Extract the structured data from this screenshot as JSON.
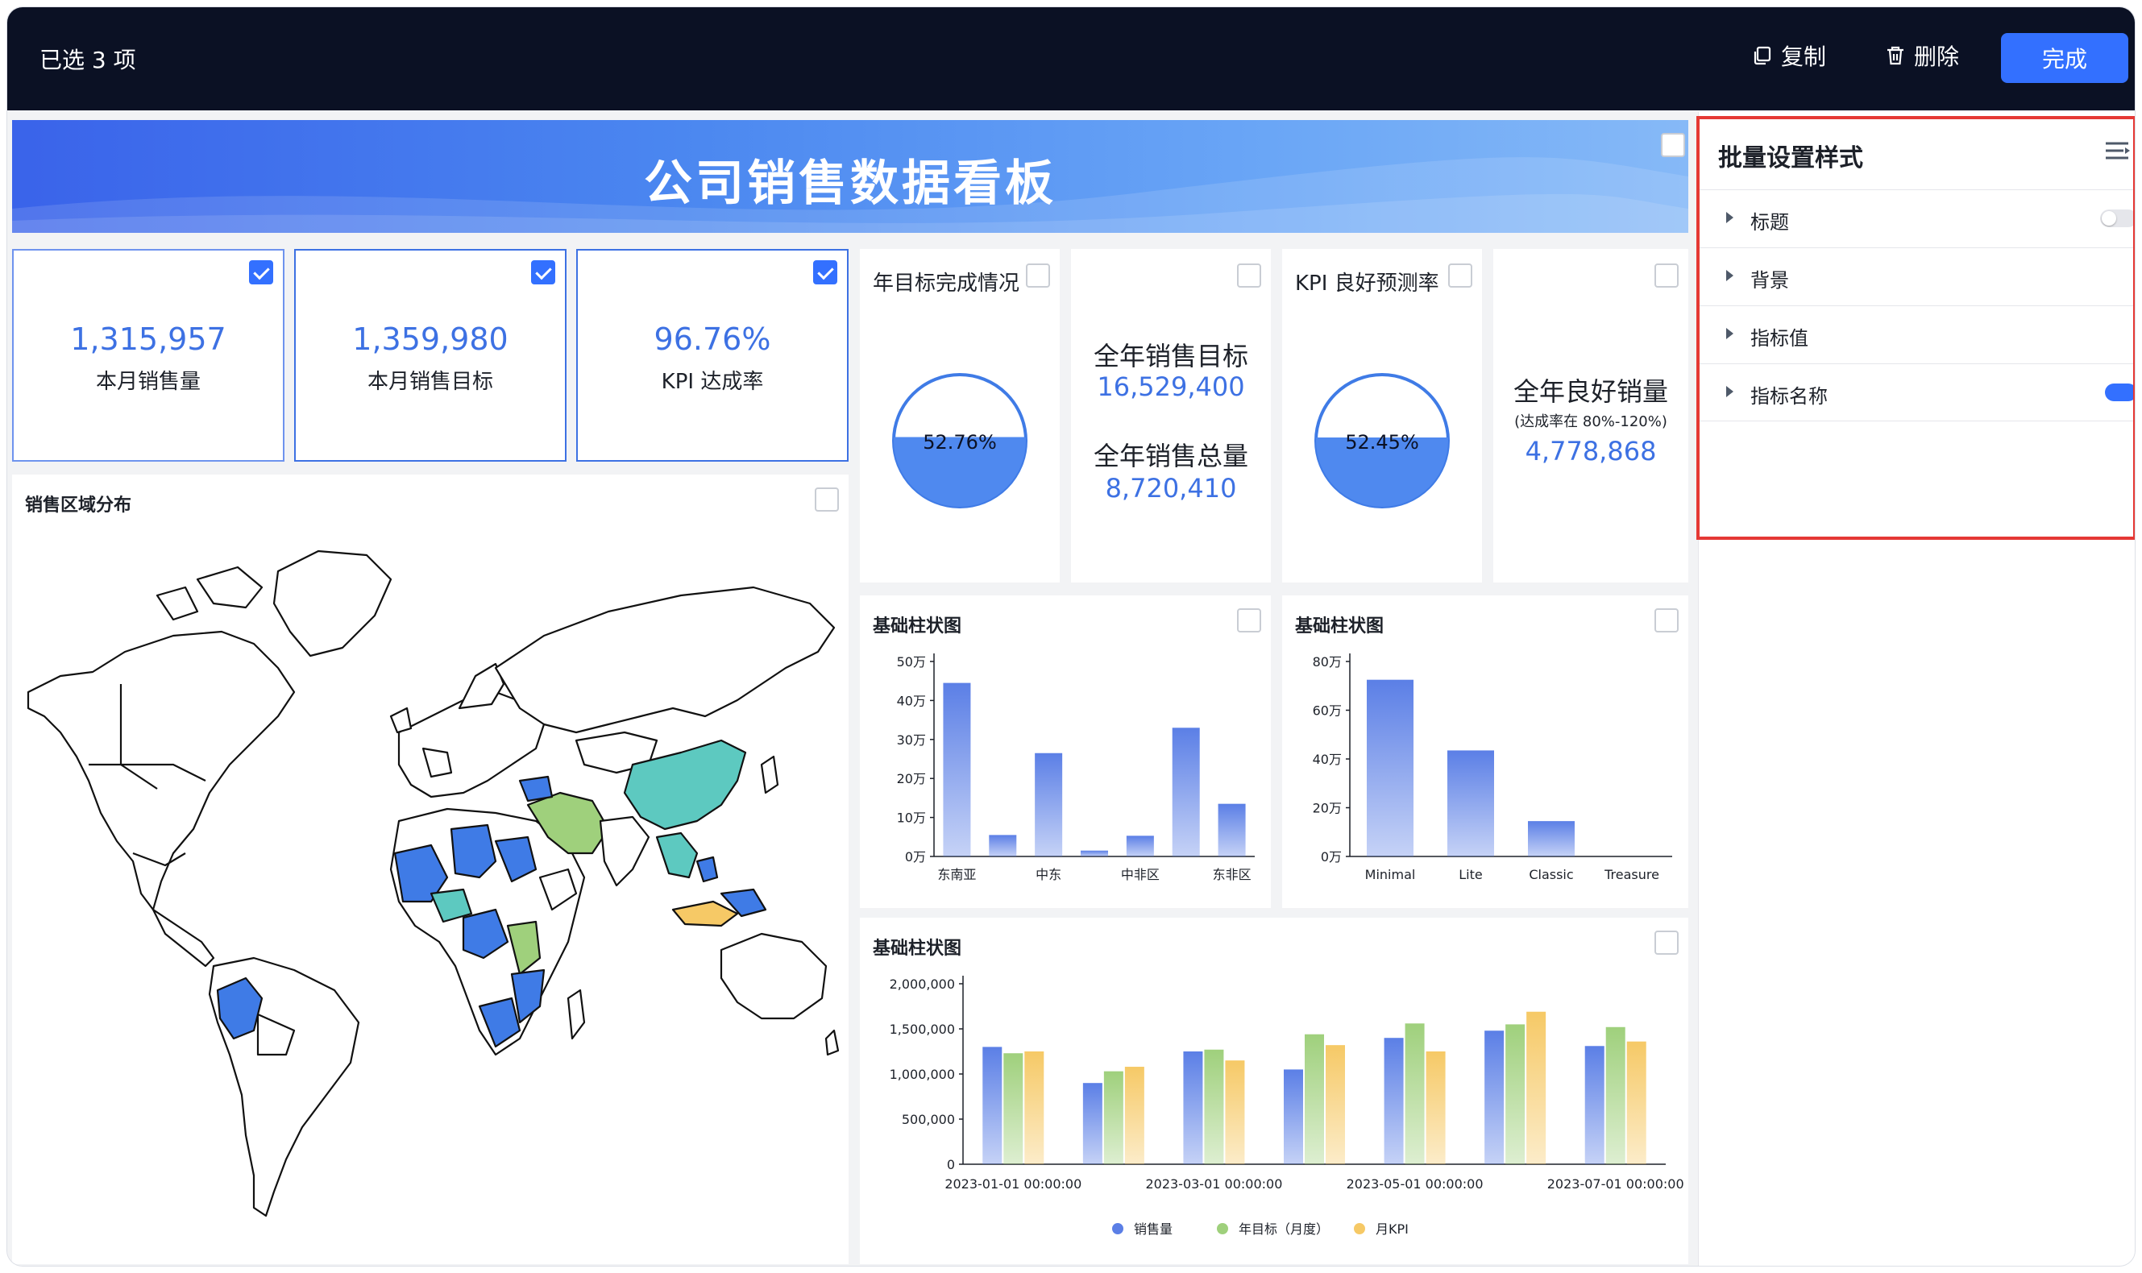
{
  "topbar": {
    "selected": "已选 3 项",
    "copy": "复制",
    "delete": "删除",
    "done": "完成"
  },
  "banner": {
    "title": "公司销售数据看板"
  },
  "kpis": [
    {
      "value": "1,315,957",
      "label": "本月销售量",
      "checked": true
    },
    {
      "value": "1,359,980",
      "label": "本月销售目标",
      "checked": true
    },
    {
      "value": "96.76%",
      "label": "KPI 达成率",
      "checked": true
    }
  ],
  "map": {
    "title": "销售区域分布"
  },
  "gauge1": {
    "title": "年目标完成情况",
    "percent_text": "52.76%",
    "percent": 0.5276
  },
  "yearCard": {
    "target_label": "全年销售目标",
    "target_value": "16,529,400",
    "total_label": "全年销售总量",
    "total_value": "8,720,410"
  },
  "gauge2": {
    "title": "KPI 良好预测率",
    "percent_text": "52.45%",
    "percent": 0.5245
  },
  "goodCard": {
    "label": "全年良好销量",
    "sub": "(达成率在 80%-120%)",
    "value": "4,778,868"
  },
  "colors": {
    "primary": "#3370ff",
    "value_blue": "#3d71e3",
    "series_blue": "#5b7fe6",
    "series_green": "#9fd07c",
    "series_yellow": "#f6c966",
    "highlight": "#e53935"
  },
  "chart_data": [
    {
      "type": "bar",
      "title": "基础柱状图",
      "ylim": [
        0,
        50
      ],
      "yticks": [
        "0万",
        "10万",
        "20万",
        "30万",
        "40万",
        "50万"
      ],
      "categories": [
        "东南亚",
        "",
        "中东",
        "",
        "中非区",
        "",
        "东非区"
      ],
      "x_labels": [
        "东南亚",
        "中东",
        "中非区",
        "东非区"
      ],
      "values": [
        44.5,
        5.5,
        26.5,
        1.5,
        5.3,
        33,
        13.5
      ]
    },
    {
      "type": "bar",
      "title": "基础柱状图",
      "ylim": [
        0,
        80
      ],
      "yticks": [
        "0万",
        "20万",
        "40万",
        "60万",
        "80万"
      ],
      "categories": [
        "Minimal",
        "Lite",
        "Classic",
        "Treasure"
      ],
      "values": [
        72.5,
        43.5,
        14.5,
        0
      ]
    },
    {
      "type": "bar",
      "title": "基础柱状图",
      "ylim": [
        0,
        2000000
      ],
      "yticks": [
        "0",
        "500,000",
        "1,000,000",
        "1,500,000",
        "2,000,000"
      ],
      "x_labels": [
        "2023-01-01 00:00:00",
        "2023-03-01 00:00:00",
        "2023-05-01 00:00:00",
        "2023-07-01 00:00:00"
      ],
      "categories": [
        "2023-01",
        "2023-02",
        "2023-03",
        "2023-04",
        "2023-05",
        "2023-06",
        "2023-07"
      ],
      "series": [
        {
          "name": "销售量",
          "values": [
            1300000,
            900000,
            1250000,
            1050000,
            1400000,
            1480000,
            1310000
          ]
        },
        {
          "name": "年目标（月度）",
          "values": [
            1230000,
            1030000,
            1270000,
            1440000,
            1560000,
            1550000,
            1520000
          ]
        },
        {
          "name": "月KPI",
          "values": [
            1250000,
            1080000,
            1150000,
            1320000,
            1250000,
            1690000,
            1360000
          ]
        }
      ]
    }
  ],
  "sidebar": {
    "title": "批量设置样式",
    "items": [
      {
        "label": "标题",
        "toggle": "off"
      },
      {
        "label": "背景",
        "toggle": "none"
      },
      {
        "label": "指标值",
        "toggle": "none"
      },
      {
        "label": "指标名称",
        "toggle": "on"
      }
    ]
  }
}
